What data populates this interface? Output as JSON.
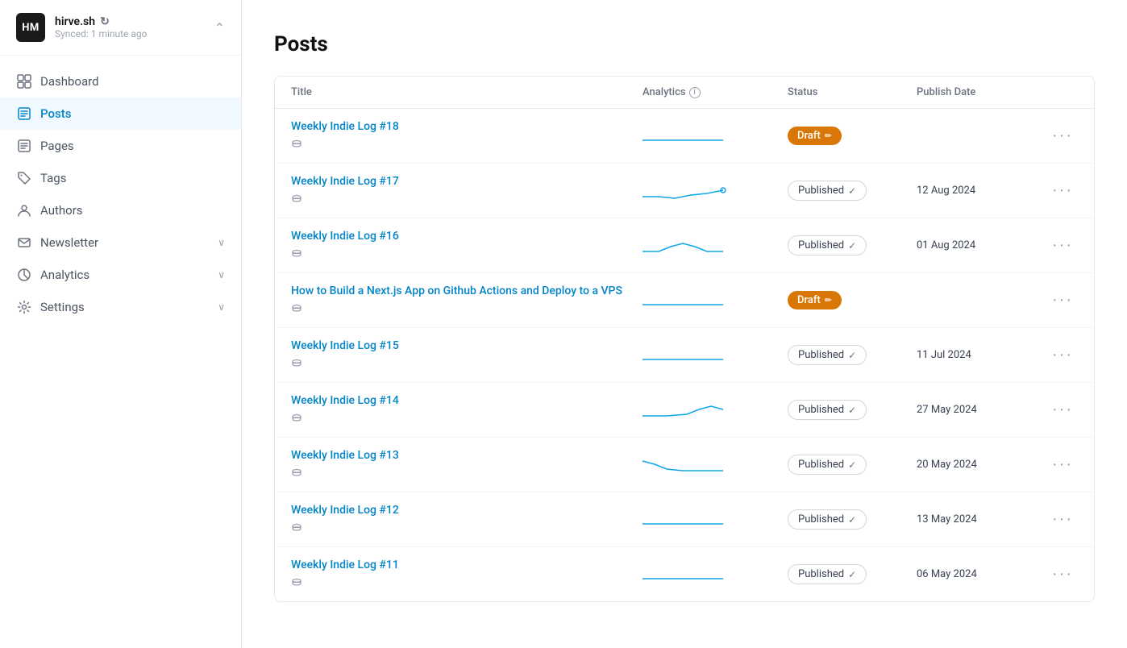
{
  "sidebar": {
    "workspace": {
      "logo": "HM",
      "name": "hirve.sh",
      "sync_status": "Synced: 1 minute ago"
    },
    "nav_items": [
      {
        "id": "dashboard",
        "label": "Dashboard",
        "icon": "grid"
      },
      {
        "id": "posts",
        "label": "Posts",
        "icon": "file-text",
        "active": true
      },
      {
        "id": "pages",
        "label": "Pages",
        "icon": "file"
      },
      {
        "id": "tags",
        "label": "Tags",
        "icon": "tag"
      },
      {
        "id": "authors",
        "label": "Authors",
        "icon": "user"
      },
      {
        "id": "newsletter",
        "label": "Newsletter",
        "icon": "mail",
        "expandable": true
      },
      {
        "id": "analytics",
        "label": "Analytics",
        "icon": "bar-chart",
        "expandable": true
      },
      {
        "id": "settings",
        "label": "Settings",
        "icon": "settings",
        "expandable": true
      }
    ]
  },
  "main": {
    "page_title": "Posts",
    "table": {
      "columns": [
        "Title",
        "Analytics",
        "Status",
        "Publish Date"
      ],
      "rows": [
        {
          "id": 1,
          "title": "Weekly Indie Log #18",
          "status": "draft",
          "status_label": "Draft",
          "publish_date": "",
          "spark_type": "flat"
        },
        {
          "id": 2,
          "title": "Weekly Indie Log #17",
          "status": "published",
          "status_label": "Published",
          "publish_date": "12 Aug 2024",
          "spark_type": "dip-rise"
        },
        {
          "id": 3,
          "title": "Weekly Indie Log #16",
          "status": "published",
          "status_label": "Published",
          "publish_date": "01 Aug 2024",
          "spark_type": "peak"
        },
        {
          "id": 4,
          "title": "How to Build a Next.js App on Github Actions and Deploy to a VPS",
          "status": "draft",
          "status_label": "Draft",
          "publish_date": "",
          "spark_type": "flat"
        },
        {
          "id": 5,
          "title": "Weekly Indie Log #15",
          "status": "published",
          "status_label": "Published",
          "publish_date": "11 Jul 2024",
          "spark_type": "flat"
        },
        {
          "id": 6,
          "title": "Weekly Indie Log #14",
          "status": "published",
          "status_label": "Published",
          "publish_date": "27 May 2024",
          "spark_type": "rise-peak"
        },
        {
          "id": 7,
          "title": "Weekly Indie Log #13",
          "status": "published",
          "status_label": "Published",
          "publish_date": "20 May 2024",
          "spark_type": "fall"
        },
        {
          "id": 8,
          "title": "Weekly Indie Log #12",
          "status": "published",
          "status_label": "Published",
          "publish_date": "13 May 2024",
          "spark_type": "flat"
        },
        {
          "id": 9,
          "title": "Weekly Indie Log #11",
          "status": "published",
          "status_label": "Published",
          "publish_date": "06 May 2024",
          "spark_type": "flat"
        }
      ]
    }
  },
  "icons": {
    "grid": "⊞",
    "more": "•••",
    "check": "✓",
    "pencil": "✏"
  }
}
